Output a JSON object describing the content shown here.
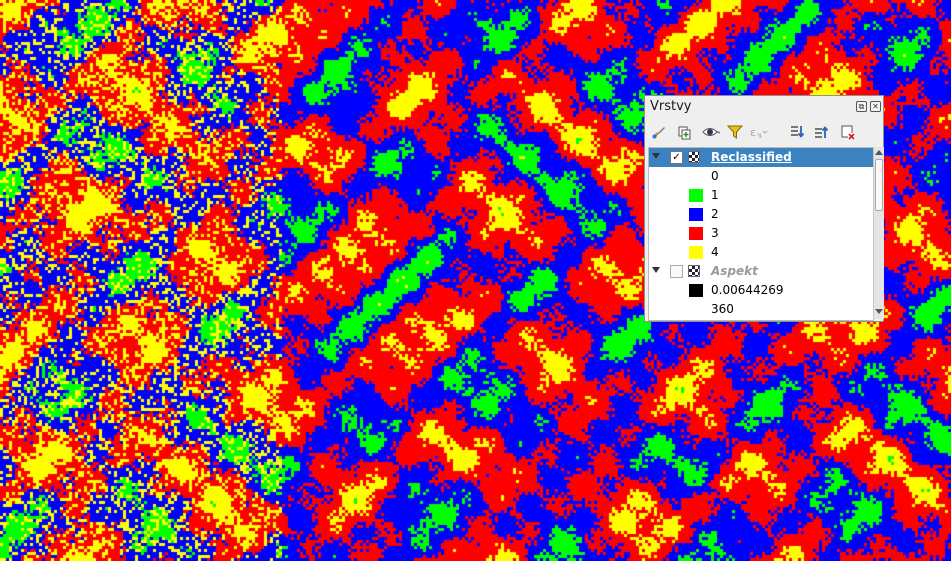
{
  "map": {
    "palette": [
      "#00ff00",
      "#0000ff",
      "#ff0000",
      "#ffff00"
    ]
  },
  "panel": {
    "title": "Vrstvy",
    "toolbar_icons": [
      "paint-brush-icon",
      "add-group-icon",
      "eye-icon",
      "filter-icon",
      "filter-expression-icon",
      "expand-all-icon",
      "collapse-all-icon",
      "remove-layer-icon"
    ]
  },
  "layers": [
    {
      "name": "Reclassified",
      "checked": true,
      "selected": true,
      "legend": [
        {
          "label": "0",
          "color": null
        },
        {
          "label": "1",
          "color": "#00ff00"
        },
        {
          "label": "2",
          "color": "#0000ff"
        },
        {
          "label": "3",
          "color": "#ff0000"
        },
        {
          "label": "4",
          "color": "#ffff00"
        }
      ]
    },
    {
      "name": "Aspekt",
      "checked": false,
      "selected": false,
      "legend": [
        {
          "label": "0.00644269",
          "color": "#000000"
        },
        {
          "label": "360",
          "color": null
        }
      ]
    }
  ]
}
